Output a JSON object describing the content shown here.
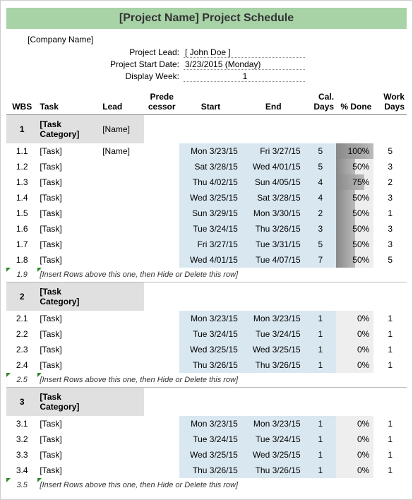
{
  "title": "[Project Name] Project Schedule",
  "company": "[Company Name]",
  "meta": {
    "lead_label": "Project Lead:",
    "lead_value": "[ John Doe ]",
    "start_label": "Project Start Date:",
    "start_value": "3/23/2015 (Monday)",
    "week_label": "Display Week:",
    "week_value": "1"
  },
  "headers": {
    "wbs": "WBS",
    "task": "Task",
    "lead": "Lead",
    "pred": "Prede cessor",
    "start": "Start",
    "end": "End",
    "caldays": "Cal. Days",
    "pct": "% Done",
    "workdays": "Work Days"
  },
  "section1": {
    "wbs": "1",
    "category": "[Task Category]",
    "lead": "[Name]",
    "rows": [
      {
        "wbs": "1.1",
        "task": "[Task]",
        "lead": "[Name]",
        "start": "Mon 3/23/15",
        "end": "Fri 3/27/15",
        "cal": "5",
        "pct": "100%",
        "pctw": 100,
        "work": "5"
      },
      {
        "wbs": "1.2",
        "task": "[Task]",
        "lead": "",
        "start": "Sat 3/28/15",
        "end": "Wed 4/01/15",
        "cal": "5",
        "pct": "50%",
        "pctw": 50,
        "work": "3"
      },
      {
        "wbs": "1.3",
        "task": "[Task]",
        "lead": "",
        "start": "Thu 4/02/15",
        "end": "Sun 4/05/15",
        "cal": "4",
        "pct": "75%",
        "pctw": 75,
        "work": "2"
      },
      {
        "wbs": "1.4",
        "task": "[Task]",
        "lead": "",
        "start": "Wed 3/25/15",
        "end": "Sat 3/28/15",
        "cal": "4",
        "pct": "50%",
        "pctw": 50,
        "work": "3"
      },
      {
        "wbs": "1.5",
        "task": "[Task]",
        "lead": "",
        "start": "Sun 3/29/15",
        "end": "Mon 3/30/15",
        "cal": "2",
        "pct": "50%",
        "pctw": 50,
        "work": "1"
      },
      {
        "wbs": "1.6",
        "task": "[Task]",
        "lead": "",
        "start": "Tue 3/24/15",
        "end": "Thu 3/26/15",
        "cal": "3",
        "pct": "50%",
        "pctw": 50,
        "work": "3"
      },
      {
        "wbs": "1.7",
        "task": "[Task]",
        "lead": "",
        "start": "Fri 3/27/15",
        "end": "Tue 3/31/15",
        "cal": "5",
        "pct": "50%",
        "pctw": 50,
        "work": "3"
      },
      {
        "wbs": "1.8",
        "task": "[Task]",
        "lead": "",
        "start": "Wed 4/01/15",
        "end": "Tue 4/07/15",
        "cal": "7",
        "pct": "50%",
        "pctw": 50,
        "work": "5"
      }
    ],
    "insert_wbs": "1.9",
    "insert": "[Insert Rows above this one, then Hide or Delete this row]"
  },
  "section2": {
    "wbs": "2",
    "category": "[Task Category]",
    "rows": [
      {
        "wbs": "2.1",
        "task": "[Task]",
        "lead": "",
        "start": "Mon 3/23/15",
        "end": "Mon 3/23/15",
        "cal": "1",
        "pct": "0%",
        "pctw": 0,
        "work": "1"
      },
      {
        "wbs": "2.2",
        "task": "[Task]",
        "lead": "",
        "start": "Tue 3/24/15",
        "end": "Tue 3/24/15",
        "cal": "1",
        "pct": "0%",
        "pctw": 0,
        "work": "1"
      },
      {
        "wbs": "2.3",
        "task": "[Task]",
        "lead": "",
        "start": "Wed 3/25/15",
        "end": "Wed 3/25/15",
        "cal": "1",
        "pct": "0%",
        "pctw": 0,
        "work": "1"
      },
      {
        "wbs": "2.4",
        "task": "[Task]",
        "lead": "",
        "start": "Thu 3/26/15",
        "end": "Thu 3/26/15",
        "cal": "1",
        "pct": "0%",
        "pctw": 0,
        "work": "1"
      }
    ],
    "insert_wbs": "2.5",
    "insert": "[Insert Rows above this one, then Hide or Delete this row]"
  },
  "section3": {
    "wbs": "3",
    "category": "[Task Category]",
    "rows": [
      {
        "wbs": "3.1",
        "task": "[Task]",
        "lead": "",
        "start": "Mon 3/23/15",
        "end": "Mon 3/23/15",
        "cal": "1",
        "pct": "0%",
        "pctw": 0,
        "work": "1"
      },
      {
        "wbs": "3.2",
        "task": "[Task]",
        "lead": "",
        "start": "Tue 3/24/15",
        "end": "Tue 3/24/15",
        "cal": "1",
        "pct": "0%",
        "pctw": 0,
        "work": "1"
      },
      {
        "wbs": "3.3",
        "task": "[Task]",
        "lead": "",
        "start": "Wed 3/25/15",
        "end": "Wed 3/25/15",
        "cal": "1",
        "pct": "0%",
        "pctw": 0,
        "work": "1"
      },
      {
        "wbs": "3.4",
        "task": "[Task]",
        "lead": "",
        "start": "Thu 3/26/15",
        "end": "Thu 3/26/15",
        "cal": "1",
        "pct": "0%",
        "pctw": 0,
        "work": "1"
      }
    ],
    "insert_wbs": "3.5",
    "insert": "[Insert Rows above this one, then Hide or Delete this row]"
  }
}
